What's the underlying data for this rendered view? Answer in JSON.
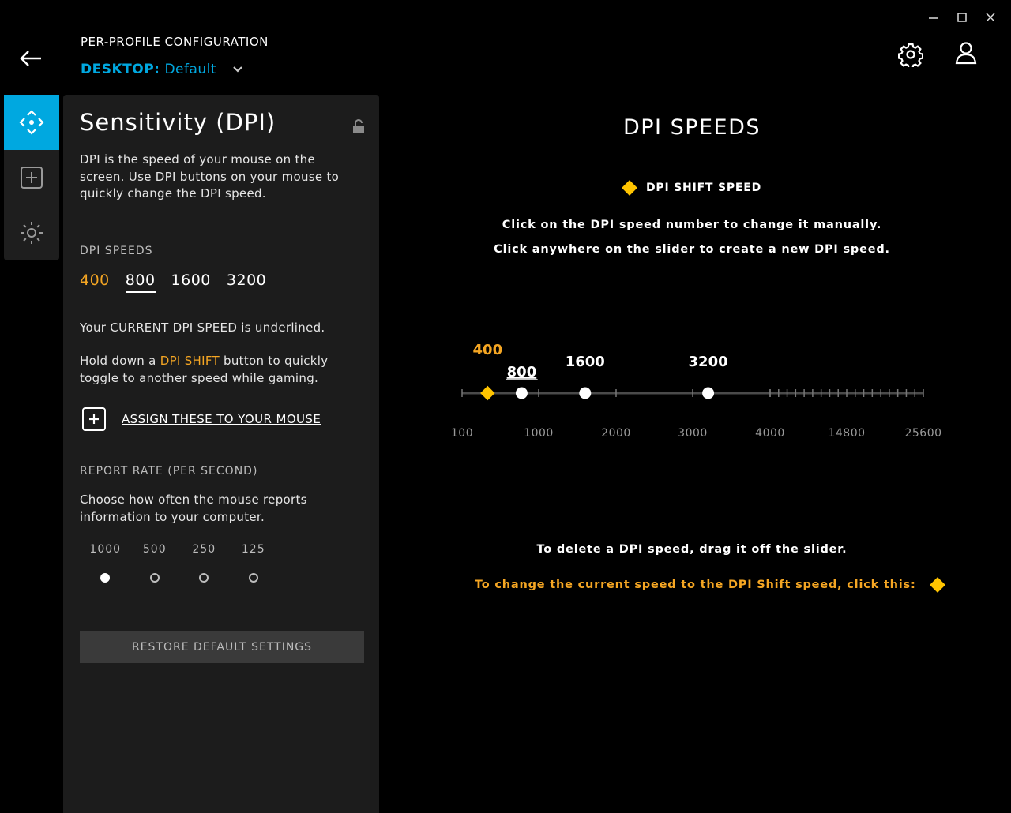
{
  "window": {
    "minimize_icon": "minimize-icon",
    "maximize_icon": "maximize-icon",
    "close_icon": "close-icon"
  },
  "header": {
    "title": "PER-PROFILE CONFIGURATION",
    "profile_kind": "DESKTOP:",
    "profile_name": "Default"
  },
  "sidebar": {
    "items": [
      {
        "icon": "move-arrows-icon",
        "active": true
      },
      {
        "icon": "plus-square-icon",
        "active": false
      },
      {
        "icon": "sun-lighting-icon",
        "active": false
      }
    ]
  },
  "panel": {
    "title": "Sensitivity (DPI)",
    "description": "DPI is the speed of your mouse on the screen. Use DPI buttons on your mouse to quickly change the DPI speed.",
    "dpi_speeds_label": "DPI SPEEDS",
    "dpi_speeds": [
      "400",
      "800",
      "1600",
      "3200"
    ],
    "current_note": "Your CURRENT DPI SPEED is underlined.",
    "shift_note_before": "Hold down a ",
    "shift_note_highlight": "DPI SHIFT",
    "shift_note_after": " button to quickly toggle to another speed while gaming.",
    "assign_label": "ASSIGN THESE TO YOUR MOUSE",
    "report_rate_label": "REPORT RATE (PER SECOND)",
    "report_rate_desc": "Choose how often the mouse reports information to your computer.",
    "report_rates": [
      "1000",
      "500",
      "250",
      "125"
    ],
    "report_rate_selected": "1000",
    "restore_label": "RESTORE DEFAULT SETTINGS"
  },
  "main": {
    "title": "DPI SPEEDS",
    "legend_label": "DPI SHIFT SPEED",
    "instruction_1": "Click on the DPI speed number to change it manually.",
    "instruction_2": "Click anywhere on the slider to create a new DPI speed.",
    "delete_note": "To delete a DPI speed, drag it off the slider.",
    "shift_note": "To change the current speed to the DPI Shift speed, click this:",
    "colors": {
      "shift": "#ffc400",
      "accent": "#00a8e0"
    }
  },
  "slider": {
    "axis_labels": [
      "100",
      "1000",
      "2000",
      "3000",
      "4000",
      "14800",
      "25600"
    ],
    "markers": [
      {
        "label": "400",
        "dpi": 400,
        "type": "shift"
      },
      {
        "label": "800",
        "dpi": 800,
        "type": "current"
      },
      {
        "label": "1600",
        "dpi": 1600,
        "type": "normal"
      },
      {
        "label": "3200",
        "dpi": 3200,
        "type": "normal"
      }
    ]
  }
}
